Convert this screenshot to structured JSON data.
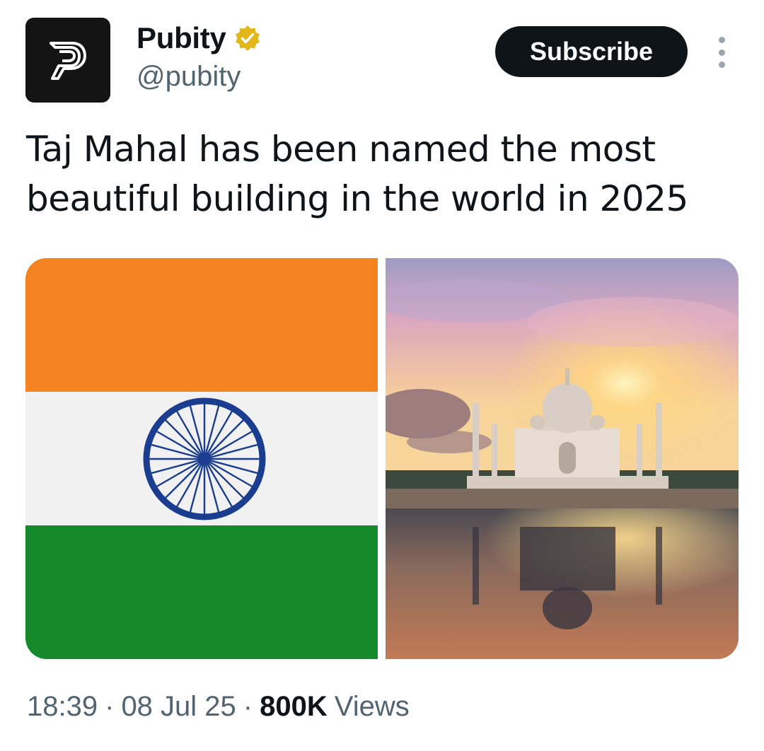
{
  "author": {
    "display_name": "Pubity",
    "handle": "@pubity",
    "avatar_icon": "pubity-logo-icon",
    "verified": true,
    "verified_color": "#e2b719"
  },
  "actions": {
    "subscribe_label": "Subscribe",
    "more_icon": "more-vertical-icon"
  },
  "tweet": {
    "text": "Taj Mahal has been named the most beautiful building in the world in 2025"
  },
  "media": [
    {
      "description": "India flag",
      "icon": "india-flag-image"
    },
    {
      "description": "Taj Mahal at sunset",
      "icon": "taj-mahal-image"
    }
  ],
  "meta": {
    "time": "18:39",
    "date": "08 Jul 25",
    "views_count": "800K",
    "views_label": "Views"
  },
  "colors": {
    "saffron": "#f58220",
    "white": "#f1f1f1",
    "green": "#148a2a",
    "chakra_blue": "#1a3d8f",
    "button_bg": "#0f1419",
    "secondary_text": "#536471"
  }
}
